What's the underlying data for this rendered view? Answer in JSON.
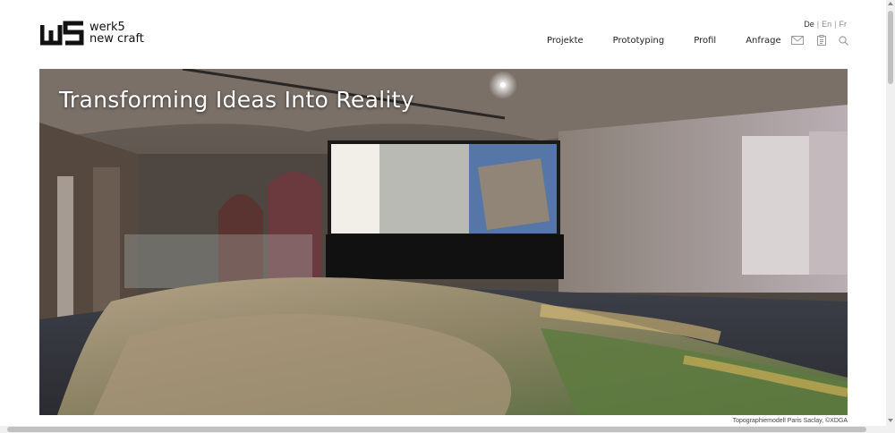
{
  "brand": {
    "line1": "werk5",
    "line2": "new craft"
  },
  "languages": [
    {
      "label": "De",
      "active": true
    },
    {
      "label": "En",
      "active": false
    },
    {
      "label": "Fr",
      "active": false
    }
  ],
  "language_separator": "|",
  "nav": {
    "items": [
      "Projekte",
      "Prototyping",
      "Profil",
      "Anfrage"
    ]
  },
  "nav_icons": [
    "mail-icon",
    "document-icon",
    "search-icon"
  ],
  "hero": {
    "title": "Transforming Ideas Into Reality",
    "caption": "Topographiemodell Paris Saclay, ©XDGA"
  },
  "colors": {
    "background": "#ffffff",
    "text": "#222222",
    "icon_gray": "#9a9a9a"
  }
}
